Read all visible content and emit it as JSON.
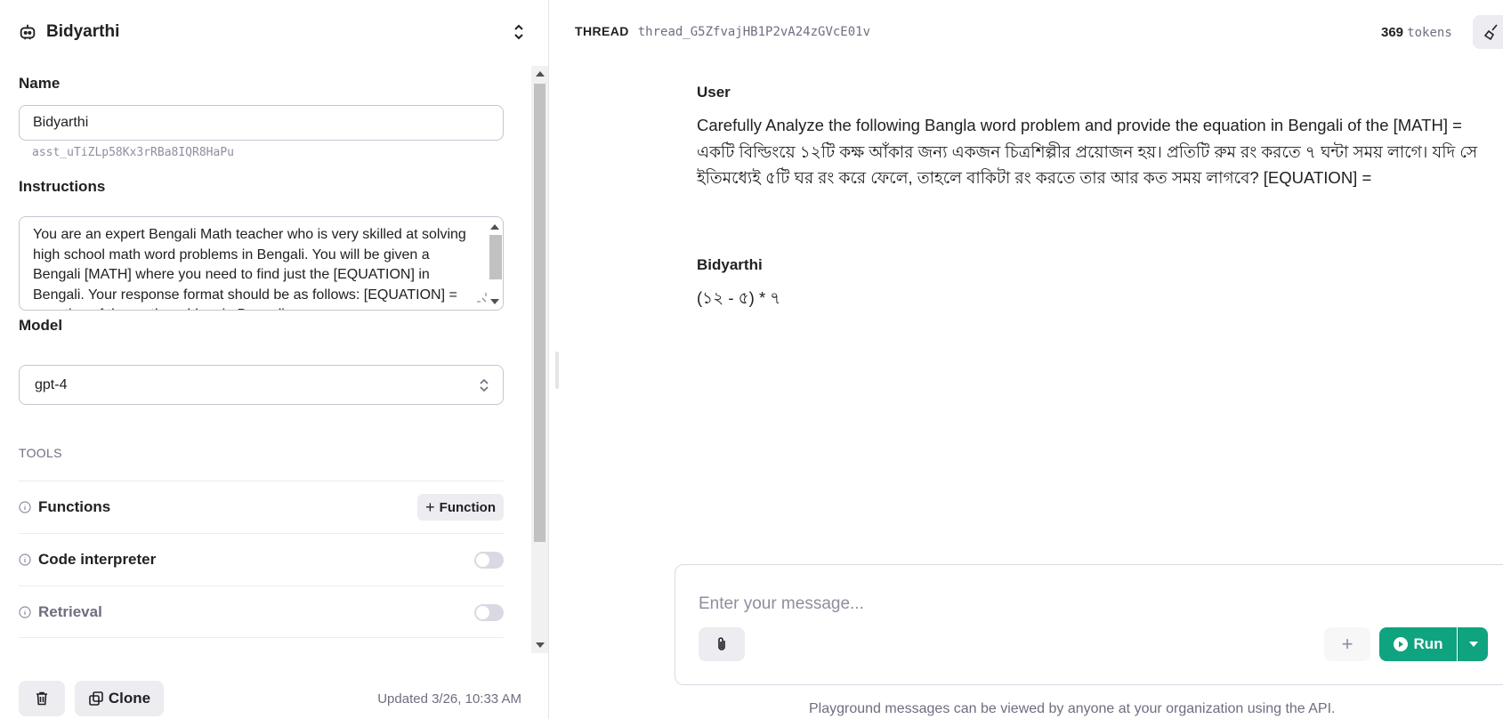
{
  "assistant": {
    "title": "Bidyarthi",
    "name_label": "Name",
    "name_value": "Bidyarthi",
    "id": "asst_uTiZLp58Kx3rRBa8IQR8HaPu",
    "instructions_label": "Instructions",
    "instructions_value": "You are an expert Bengali Math teacher who is very skilled at solving high school math word problems in Bengali. You will be given a Bengali [MATH] where you need to find just the [EQUATION] in Bengali. Your response format should be as follows: [EQUATION] = equation of the math problem in Bengali",
    "model_label": "Model",
    "model_value": "gpt-4",
    "tools_label": "TOOLS",
    "tools": [
      {
        "name": "Functions",
        "action": "Function",
        "type": "button",
        "enabled": true
      },
      {
        "name": "Code interpreter",
        "type": "toggle",
        "enabled": false
      },
      {
        "name": "Retrieval",
        "type": "toggle",
        "enabled": false
      }
    ],
    "delete_icon": "trash-icon",
    "clone_label": "Clone",
    "updated_text": "Updated 3/26, 10:33 AM"
  },
  "thread": {
    "label": "THREAD",
    "id": "thread_G5ZfvajHB1P2vA24zGVcE01v",
    "token_count": "369",
    "token_word": "tokens",
    "messages": [
      {
        "role": "User",
        "text": "Carefully Analyze the following Bangla word problem and provide the equation in Bengali of the [MATH] = একটি বিল্ডিংয়ে ১২টি কক্ষ আঁকার জন্য একজন চিত্রশিল্পীর প্রয়োজন হয়। প্রতিটি রুম রং করতে ৭ ঘন্টা সময় লাগে। যদি সে ইতিমধ্যেই ৫টি ঘর রং করে ফেলে, তাহলে বাকিটা রং করতে তার আর কত সময় লাগবে? [EQUATION] ="
      },
      {
        "role": "Bidyarthi",
        "text": "(১২ - ৫) * ৭"
      }
    ]
  },
  "composer": {
    "placeholder": "Enter your message...",
    "run_label": "Run",
    "footer": "Playground messages can be viewed by anyone at your organization using the API."
  },
  "colors": {
    "accent": "#10a37f",
    "muted": "#6e6e80",
    "border": "#c5c5d2"
  }
}
